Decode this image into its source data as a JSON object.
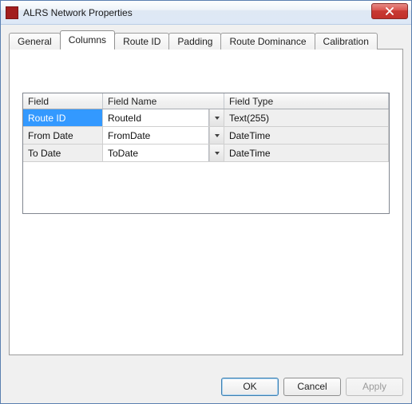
{
  "window": {
    "title": "ALRS Network Properties"
  },
  "tabs": [
    {
      "label": "General",
      "active": false
    },
    {
      "label": "Columns",
      "active": true
    },
    {
      "label": "Route ID",
      "active": false
    },
    {
      "label": "Padding",
      "active": false
    },
    {
      "label": "Route Dominance",
      "active": false
    },
    {
      "label": "Calibration",
      "active": false
    }
  ],
  "grid": {
    "headers": {
      "field": "Field",
      "fieldName": "Field Name",
      "fieldType": "Field Type"
    },
    "rows": [
      {
        "field": "Route ID",
        "fieldName": "RouteId",
        "fieldType": "Text(255)",
        "selected": true
      },
      {
        "field": "From Date",
        "fieldName": "FromDate",
        "fieldType": "DateTime",
        "selected": false
      },
      {
        "field": "To Date",
        "fieldName": "ToDate",
        "fieldType": "DateTime",
        "selected": false
      }
    ]
  },
  "buttons": {
    "ok": "OK",
    "cancel": "Cancel",
    "apply": "Apply"
  },
  "icons": {
    "close": "close-icon",
    "app": "grid-icon",
    "dropdown": "chevron-down-icon"
  }
}
